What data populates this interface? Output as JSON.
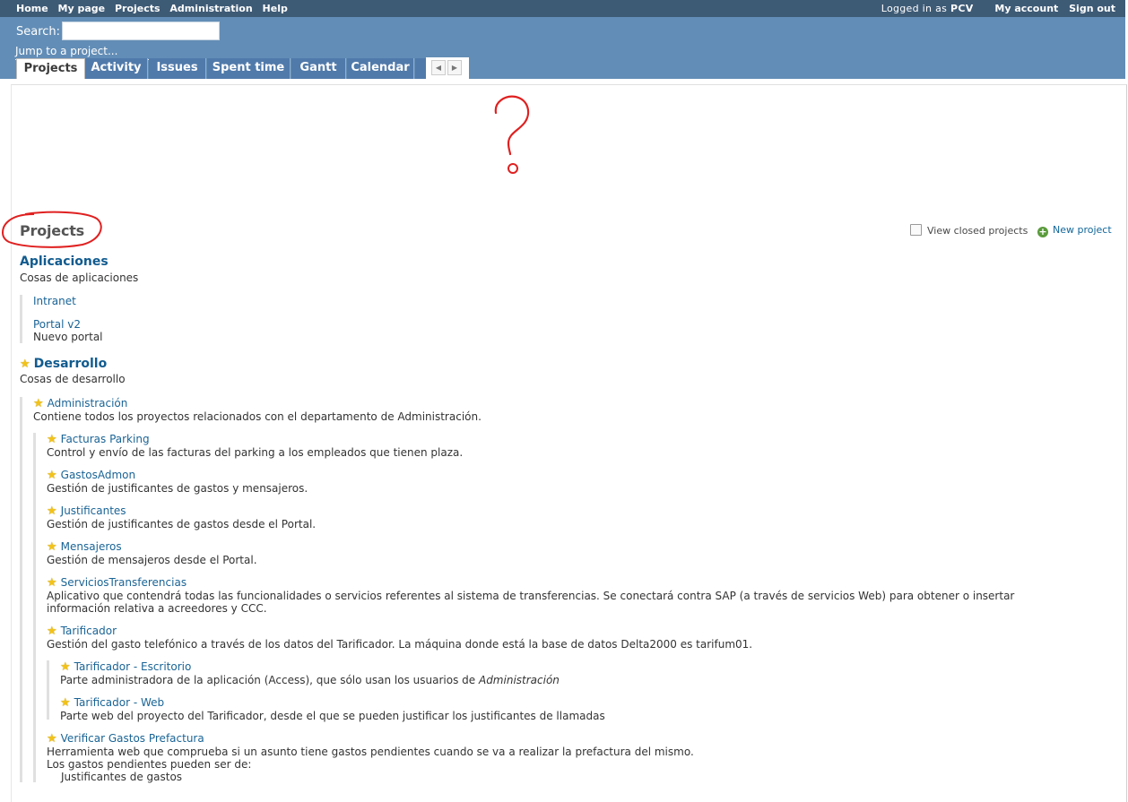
{
  "top_menu": {
    "items": [
      "Home",
      "My page",
      "Projects",
      "Administration",
      "Help"
    ],
    "logged_in_prefix": "Logged in as",
    "user": "PCV",
    "my_account": "My account",
    "sign_out": "Sign out"
  },
  "header": {
    "search_label": "Search:",
    "search_value": "",
    "jump_to_project": "Jump to a project..."
  },
  "tabs": [
    "Projects",
    "Activity",
    "Issues",
    "Spent time",
    "Gantt",
    "Calendar"
  ],
  "selected_tab": "Projects",
  "page": {
    "title": "Projects",
    "view_closed_label": "View closed projects",
    "view_closed_checked": false,
    "new_project_label": "New project"
  },
  "projects": {
    "aplicaciones": {
      "name": "Aplicaciones",
      "description": "Cosas de aplicaciones",
      "children": [
        {
          "name": "Intranet",
          "description": ""
        },
        {
          "name": "Portal v2",
          "description": "Nuevo portal"
        }
      ]
    },
    "desarrollo": {
      "name": "Desarrollo",
      "description": "Cosas de desarrollo",
      "administracion": {
        "name": "Administración",
        "description": "Contiene todos los proyectos relacionados con el departamento de Administración."
      },
      "children": [
        {
          "name": "Facturas Parking",
          "description": "Control y envío de las facturas del parking a los empleados que tienen plaza."
        },
        {
          "name": "GastosAdmon",
          "description": "Gestión de justificantes de gastos y mensajeros."
        },
        {
          "name": "Justificantes",
          "description": "Gestión de justificantes de gastos desde el Portal."
        },
        {
          "name": "Mensajeros",
          "description": "Gestión de mensajeros desde el Portal."
        },
        {
          "name": "ServiciosTransferencias",
          "description_line1": "Aplicativo que contendrá todas las funcionalidades o servicios referentes al sistema de transferencias. Se conectará contra SAP (a través de servicios Web) para obtener o insertar",
          "description_line2": "información relativa a acreedores y CCC."
        },
        {
          "name": "Tarificador",
          "description": "Gestión del gasto telefónico a través de los datos del Tarificador. La máquina donde está la base de datos Delta2000 es tarifum01."
        },
        {
          "name": "Verificar Gastos Prefactura",
          "description_line1": "Herramienta web que comprueba si un asunto tiene gastos pendientes cuando se va a realizar la prefactura del mismo.",
          "description_line2": "Los gastos pendientes pueden ser de:",
          "description_line3": "Justificantes de gastos"
        }
      ],
      "tarificador_children": [
        {
          "name": "Tarificador - Escritorio",
          "description_prefix": "Parte administradora de la aplicación (Access), que sólo usan los usuarios de ",
          "description_emphasis": "Administración"
        },
        {
          "name": "Tarificador - Web",
          "description": "Parte web del proyecto del Tarificador, desde el que se pueden justificar los justificantes de llamadas"
        }
      ]
    }
  },
  "colors": {
    "top_bar": "#3e5b76",
    "header": "#628db6",
    "tab": "#507aaa",
    "link": "#1a6496",
    "annotation": "#e02020"
  }
}
